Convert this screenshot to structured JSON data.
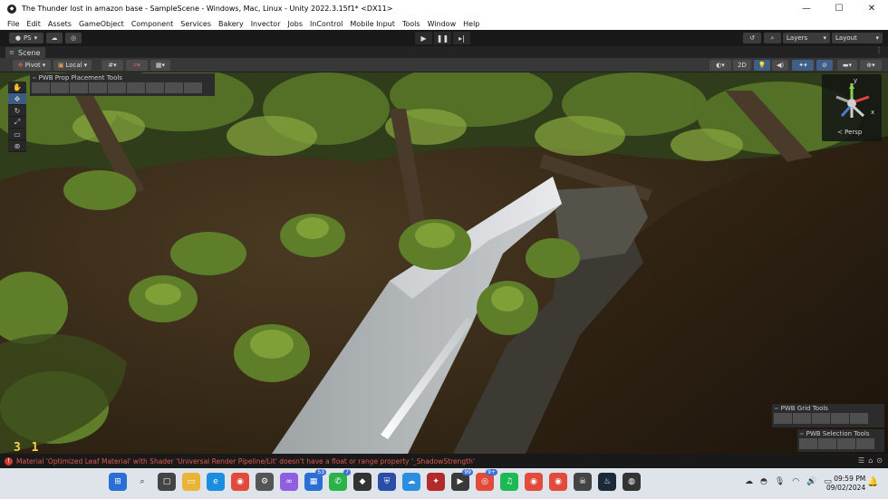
{
  "window": {
    "title": "The Thunder lost in amazon base - SampleScene - Windows, Mac, Linux - Unity 2022.3.15f1* <DX11>",
    "minimize": "—",
    "maximize": "☐",
    "close": "✕"
  },
  "menu": [
    "File",
    "Edit",
    "Assets",
    "GameObject",
    "Component",
    "Services",
    "Bakery",
    "Invector",
    "Jobs",
    "InControl",
    "Mobile Input",
    "Tools",
    "Window",
    "Help"
  ],
  "toolbar": {
    "account": "PS",
    "layers": "Layers",
    "layout": "Layout"
  },
  "scene_tab": {
    "label": "Scene"
  },
  "scene_toolbar": {
    "pivot": "Pivot",
    "local": "Local",
    "mode_2d": "2D"
  },
  "gizmo": {
    "y": "y",
    "x": "x",
    "persp": "Persp"
  },
  "pwb": {
    "prop_tools": "PWB Prop Placement Tools",
    "grid_tools": "PWB Grid Tools",
    "selection_tools": "PWB Selection Tools"
  },
  "overlay_counter": "3 1",
  "status": {
    "message": "Material 'Optimized Leaf Material' with Shader 'Universal Render Pipeline/Lit' doesn't have a float or range property '_ShadowStrength'"
  },
  "taskbar": {
    "badges": {
      "b1": "53",
      "b2": "7",
      "b3": "99",
      "b4": "9+"
    },
    "time": "09:59 PM",
    "date": "09/02/2024"
  },
  "colors": {
    "error": "#e25a4e",
    "selected_blue": "#3b5c86",
    "unity_bg": "#191919"
  }
}
